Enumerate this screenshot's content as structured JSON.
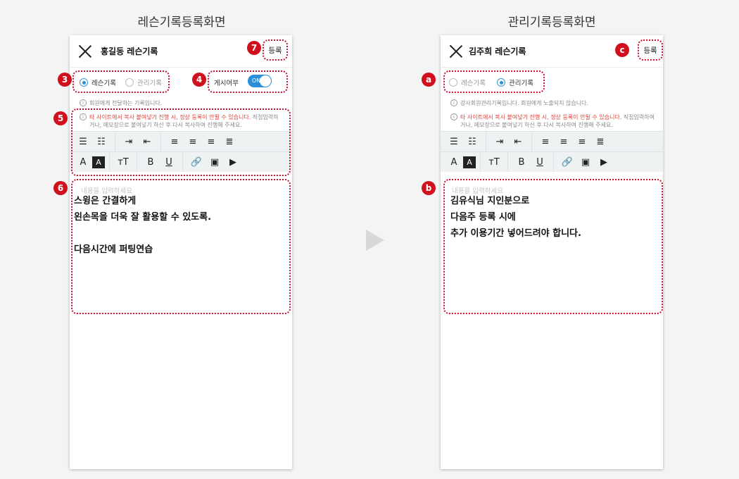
{
  "left": {
    "screen_title": "레슨기록등록화면",
    "header_title": "홍길동 레슨기록",
    "register": "등록",
    "radio_lesson": "레슨기록",
    "radio_manage": "관리기록",
    "post_label": "게시여부",
    "toggle": "ON",
    "info": "회원에게 전달하는 기록입니다.",
    "warning_red": "타 사이트에서 복사 붙여넣기 진행 시, 정상 등록이 안될 수 있습니다.",
    "warning_rest_1": " 직접입력하",
    "warning_rest_2": "거나, 메모장으로 붙여넣기 하신 후 다시 복사하여 진행해 주세요.",
    "placeholder": "내용을 입력하세요",
    "content": "스윙은 간결하게\n왼손목을 더욱 잘 활용할 수 있도록.\n\n다음시간에 퍼팅연습",
    "badges": {
      "b3": "3",
      "b4": "4",
      "b5": "5",
      "b6": "6",
      "b7": "7"
    }
  },
  "right": {
    "screen_title": "관리기록등록화면",
    "header_title": "김주희 레슨기록",
    "register": "등록",
    "radio_lesson": "레슨기록",
    "radio_manage": "관리기록",
    "info": "강사회원관리기록입니다. 회원에게 노출되지 않습니다.",
    "warning_red": "타 사이트에서 복사 붙여넣기 진행 시, 정상 등록이 안될 수 있습니다.",
    "warning_rest_1": " 직접입력하여",
    "warning_rest_2": "거나, 메모장으로 붙여넣기 하신 후 다시 복사하여 진행해 주세요.",
    "placeholder": "내용을 입력하세요",
    "content": "김유식님 지인분으로\n다음주 등록 시에\n추가 이용기간 넣어드려야 합니다.",
    "badges": {
      "ba": "a",
      "bb": "b",
      "bc": "c"
    }
  },
  "toolbar": {
    "row1": [
      "bullet-list-icon",
      "numbered-list-icon",
      "indent-icon",
      "outdent-icon",
      "align-left-icon",
      "align-center-icon",
      "align-right-icon",
      "align-justify-icon"
    ],
    "row2": [
      "font-color-icon",
      "background-color-icon",
      "font-size-icon",
      "bold-icon",
      "underline-icon",
      "link-icon",
      "image-icon",
      "video-icon"
    ],
    "bold": "B",
    "underline": "U"
  },
  "colors": {
    "accent": "#2a8fd8",
    "annotation": "#c8102e",
    "warning": "#e0413a"
  }
}
